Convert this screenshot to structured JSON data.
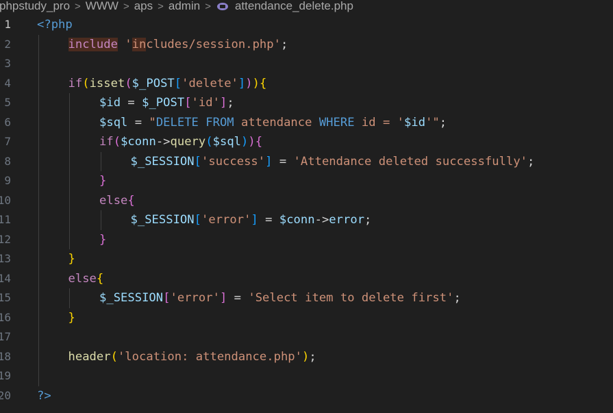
{
  "breadcrumb": {
    "segments": [
      "phpstudy_pro",
      "WWW",
      "aps",
      "admin"
    ],
    "file_icon": "php-elephant-icon",
    "file": "attendance_delete.php",
    "separator": ">"
  },
  "line_numbers": [
    "1",
    "2",
    "3",
    "4",
    "5",
    "6",
    "7",
    "8",
    "9",
    "10",
    "11",
    "12",
    "13",
    "14",
    "15",
    "16",
    "17",
    "18",
    "19",
    "20"
  ],
  "active_line": 1,
  "code_lines": [
    [
      {
        "t": "<?php",
        "c": "tag"
      }
    ],
    [
      {
        "t": "include",
        "c": "kw",
        "hl": true
      },
      {
        "t": " ",
        "c": "op"
      },
      {
        "t": "'",
        "c": "str"
      },
      {
        "t": "in",
        "c": "str",
        "hl": true
      },
      {
        "t": "cludes/session.php'",
        "c": "str"
      },
      {
        "t": ";",
        "c": "op"
      }
    ],
    [],
    [
      {
        "t": "if",
        "c": "kw"
      },
      {
        "t": "(",
        "c": "br1"
      },
      {
        "t": "isset",
        "c": "fn"
      },
      {
        "t": "(",
        "c": "br2"
      },
      {
        "t": "$_POST",
        "c": "var"
      },
      {
        "t": "[",
        "c": "br3"
      },
      {
        "t": "'delete'",
        "c": "str"
      },
      {
        "t": "]",
        "c": "br3"
      },
      {
        "t": ")",
        "c": "br2"
      },
      {
        "t": ")",
        "c": "br1"
      },
      {
        "t": "{",
        "c": "br1"
      }
    ],
    [
      {
        "t": "$id",
        "c": "var"
      },
      {
        "t": " = ",
        "c": "op"
      },
      {
        "t": "$_POST",
        "c": "var"
      },
      {
        "t": "[",
        "c": "br2"
      },
      {
        "t": "'id'",
        "c": "str"
      },
      {
        "t": "]",
        "c": "br2"
      },
      {
        "t": ";",
        "c": "op"
      }
    ],
    [
      {
        "t": "$sql",
        "c": "var"
      },
      {
        "t": " = ",
        "c": "op"
      },
      {
        "t": "\"",
        "c": "str"
      },
      {
        "t": "DELETE FROM",
        "c": "sqlkw"
      },
      {
        "t": " attendance ",
        "c": "sqlid"
      },
      {
        "t": "WHERE",
        "c": "sqlkw"
      },
      {
        "t": " id = '",
        "c": "sqlid"
      },
      {
        "t": "$id",
        "c": "var"
      },
      {
        "t": "'\"",
        "c": "str"
      },
      {
        "t": ";",
        "c": "op"
      }
    ],
    [
      {
        "t": "if",
        "c": "kw"
      },
      {
        "t": "(",
        "c": "br2"
      },
      {
        "t": "$conn",
        "c": "var"
      },
      {
        "t": "->",
        "c": "op"
      },
      {
        "t": "query",
        "c": "fn"
      },
      {
        "t": "(",
        "c": "br3"
      },
      {
        "t": "$sql",
        "c": "var"
      },
      {
        "t": ")",
        "c": "br3"
      },
      {
        "t": ")",
        "c": "br2"
      },
      {
        "t": "{",
        "c": "br2"
      }
    ],
    [
      {
        "t": "$_SESSION",
        "c": "var"
      },
      {
        "t": "[",
        "c": "br3"
      },
      {
        "t": "'success'",
        "c": "str"
      },
      {
        "t": "]",
        "c": "br3"
      },
      {
        "t": " = ",
        "c": "op"
      },
      {
        "t": "'Attendance deleted successfully'",
        "c": "str"
      },
      {
        "t": ";",
        "c": "op"
      }
    ],
    [
      {
        "t": "}",
        "c": "br2"
      }
    ],
    [
      {
        "t": "else",
        "c": "kw"
      },
      {
        "t": "{",
        "c": "br2"
      }
    ],
    [
      {
        "t": "$_SESSION",
        "c": "var"
      },
      {
        "t": "[",
        "c": "br3"
      },
      {
        "t": "'error'",
        "c": "str"
      },
      {
        "t": "]",
        "c": "br3"
      },
      {
        "t": " = ",
        "c": "op"
      },
      {
        "t": "$conn",
        "c": "var"
      },
      {
        "t": "->",
        "c": "op"
      },
      {
        "t": "error",
        "c": "var"
      },
      {
        "t": ";",
        "c": "op"
      }
    ],
    [
      {
        "t": "}",
        "c": "br2"
      }
    ],
    [
      {
        "t": "}",
        "c": "br1"
      }
    ],
    [
      {
        "t": "else",
        "c": "kw"
      },
      {
        "t": "{",
        "c": "br1"
      }
    ],
    [
      {
        "t": "$_SESSION",
        "c": "var"
      },
      {
        "t": "[",
        "c": "br2"
      },
      {
        "t": "'error'",
        "c": "str"
      },
      {
        "t": "]",
        "c": "br2"
      },
      {
        "t": " = ",
        "c": "op"
      },
      {
        "t": "'Select item to delete first'",
        "c": "str"
      },
      {
        "t": ";",
        "c": "op"
      }
    ],
    [
      {
        "t": "}",
        "c": "br1"
      }
    ],
    [],
    [
      {
        "t": "header",
        "c": "fn"
      },
      {
        "t": "(",
        "c": "br1"
      },
      {
        "t": "'location: attendance.php'",
        "c": "str"
      },
      {
        "t": ")",
        "c": "br1"
      },
      {
        "t": ";",
        "c": "op"
      }
    ],
    [],
    [
      {
        "t": "?>",
        "c": "tag"
      }
    ]
  ]
}
